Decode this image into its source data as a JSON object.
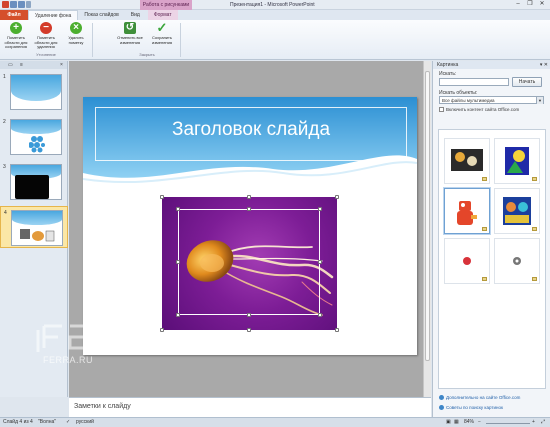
{
  "window": {
    "title": "Презентация1 - Microsoft PowerPoint",
    "context_tab": "Работа с рисунками",
    "controls": [
      "–",
      "❐",
      "✕"
    ]
  },
  "tabs": [
    {
      "label": "Файл",
      "kind": "file"
    },
    {
      "label": "Удаление фона",
      "kind": "active"
    },
    {
      "label": "Показ слайдов",
      "kind": "normal"
    },
    {
      "label": "Вид",
      "kind": "normal"
    },
    {
      "label": "Формат",
      "kind": "fmt"
    }
  ],
  "ribbon": {
    "buttons": [
      {
        "label": "Пометить области для сохранения",
        "icon": "plus-icon",
        "color": "#4caf2f"
      },
      {
        "label": "Пометить области для удаления",
        "icon": "minus-icon",
        "color": "#d33b2a"
      },
      {
        "label": "Удалить пометку",
        "icon": "eraser-icon",
        "color": "#4caf2f"
      },
      {
        "label": "Отменить все изменения",
        "icon": "discard-icon",
        "color": "#3f8f3a"
      },
      {
        "label": "Сохранить изменения",
        "icon": "checkmark-icon",
        "color": "#3aa53a"
      }
    ],
    "groups": [
      "Уточнение",
      "Закрыть"
    ]
  },
  "slides_panel": {
    "slide_numbers": [
      "1",
      "2",
      "3",
      "4"
    ],
    "active_slide": 4
  },
  "slide": {
    "title": "Заголовок слайда",
    "accent_color": "#3aa0dc",
    "photo_bg": "#7d1d96"
  },
  "notes": {
    "placeholder": "Заметки к слайду"
  },
  "clipart": {
    "header": "Картинка",
    "search_label": "Искать:",
    "search_value": "",
    "go_button": "Начать",
    "results_label": "Искать объекты:",
    "results_value": "Все файлы мультимедиа",
    "office_checkbox": "Включить контент сайта Office.com",
    "office_checked": false,
    "items": [
      {
        "name": "fruit-clipart",
        "selected": false
      },
      {
        "name": "sun-clipart",
        "selected": false
      },
      {
        "name": "robot-clipart",
        "selected": true
      },
      {
        "name": "faces-clipart",
        "selected": false
      },
      {
        "name": "red-ball-clipart",
        "selected": false
      },
      {
        "name": "disk-clipart",
        "selected": false
      }
    ],
    "links": [
      "Дополнительно на сайте Office.com",
      "Советы по поиску картинок"
    ]
  },
  "status": {
    "slide": "Слайд 4 из 4",
    "theme": "\"Волна\"",
    "language": "русский",
    "zoom": "84%"
  },
  "watermark": {
    "text": "FERRA.RU"
  }
}
